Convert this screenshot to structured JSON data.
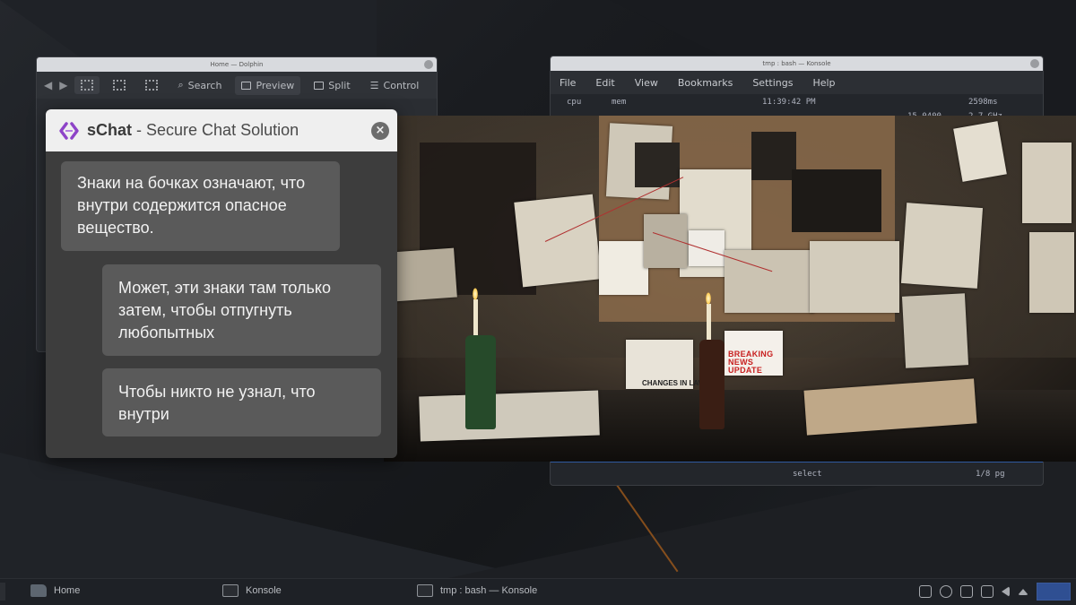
{
  "back_window_left": {
    "title": "Home — Dolphin",
    "toolbar": {
      "search": "Search",
      "preview": "Preview",
      "split": "Split",
      "control": "Control"
    }
  },
  "back_window_right": {
    "title": "tmp : bash — Konsole",
    "menu": [
      "File",
      "Edit",
      "View",
      "Bookmarks",
      "Settings",
      "Help"
    ],
    "status_top": {
      "cpu": "cpu",
      "mem": "mem",
      "time": "11:39:42 PM",
      "ms": "2598ms",
      "date": "15-0400",
      "freq": "2.7 GHz"
    },
    "status_bottom": {
      "select": "select",
      "pages": "1/8 pg"
    }
  },
  "photo": {
    "news_label": "BREAKING NEWS UPDATE",
    "laws_label": "CHANGES IN LAW"
  },
  "chat": {
    "app_name": "sChat",
    "separator": " - ",
    "subtitle": "Secure Chat Solution",
    "close_glyph": "×",
    "messages": [
      {
        "text": "Знаки на бочках означают, что внутри содержится опасное вещество.",
        "side": "left"
      },
      {
        "text": "Может, эти знаки там только затем, чтобы отпугнуть любопытных",
        "side": "right"
      },
      {
        "text": "Чтобы никто не узнал, что внутри",
        "side": "right"
      }
    ],
    "colors": {
      "header": "#efefef",
      "body": "#3d3d3d",
      "bubble": "#5a5a5a",
      "logo": "#8e44c8"
    }
  },
  "taskbar": {
    "tasks": [
      {
        "label": "Home",
        "icon": "folder-icon"
      },
      {
        "label": "Konsole",
        "icon": "terminal-icon"
      },
      {
        "label": "tmp : bash — Konsole",
        "icon": "terminal-icon"
      }
    ]
  }
}
